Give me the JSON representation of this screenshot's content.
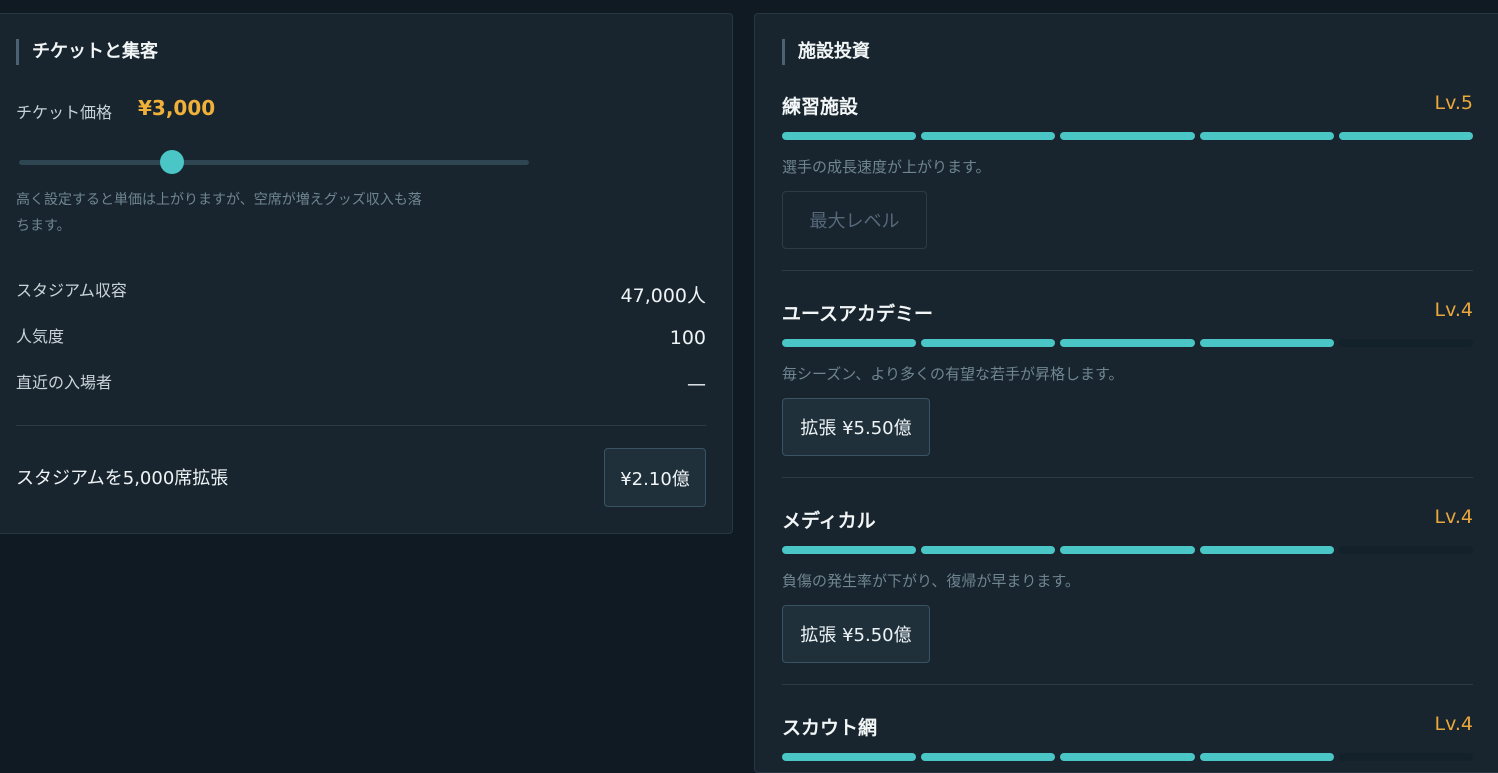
{
  "ticket_section": {
    "title": "チケットと集客",
    "price_label": "チケット価格",
    "price_value": "¥3,000",
    "slider_level": 0.3,
    "hint": "高く設定すると単価は上がりますが、空席が増えグッズ収入も落ちます。",
    "stats": [
      {
        "label": "スタジアム収容",
        "value": "47,000人"
      },
      {
        "label": "人気度",
        "value": "100"
      },
      {
        "label": "直近の入場者",
        "value": "—"
      }
    ],
    "expand_label": "スタジアムを5,000席拡張",
    "expand_button": "¥2.10億"
  },
  "facility_section": {
    "title": "施設投資",
    "max_segments": 5,
    "facilities": [
      {
        "name": "練習施設",
        "level_text": "Lv.5",
        "level": 5,
        "desc": "選手の成長速度が上がります。",
        "button": "最大レベル",
        "button_disabled": true
      },
      {
        "name": "ユースアカデミー",
        "level_text": "Lv.4",
        "level": 4,
        "desc": "毎シーズン、より多くの有望な若手が昇格します。",
        "button": "拡張 ¥5.50億",
        "button_disabled": false
      },
      {
        "name": "メディカル",
        "level_text": "Lv.4",
        "level": 4,
        "desc": "負傷の発生率が下がり、復帰が早まります。",
        "button": "拡張 ¥5.50億",
        "button_disabled": false
      },
      {
        "name": "スカウト網",
        "level_text": "Lv.4",
        "level": 4
      }
    ]
  },
  "colors": {
    "accent_teal": "#4ac6c6",
    "price_gold": "#f0b03a",
    "level_gold": "#e9a73c"
  }
}
